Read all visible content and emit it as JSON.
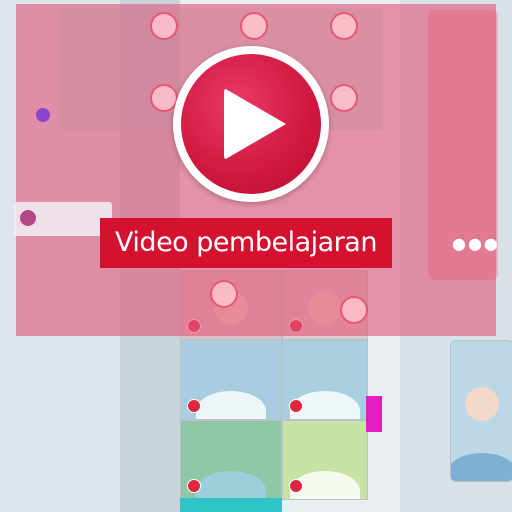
{
  "caption": {
    "text": "Video pembelajaran"
  },
  "play_button": {
    "icon": "play-icon"
  },
  "colors": {
    "overlay_tint": "#e2587a",
    "play_button_fill": "#d0173f",
    "caption_background": "#d4112f",
    "caption_text": "#ffffff"
  }
}
